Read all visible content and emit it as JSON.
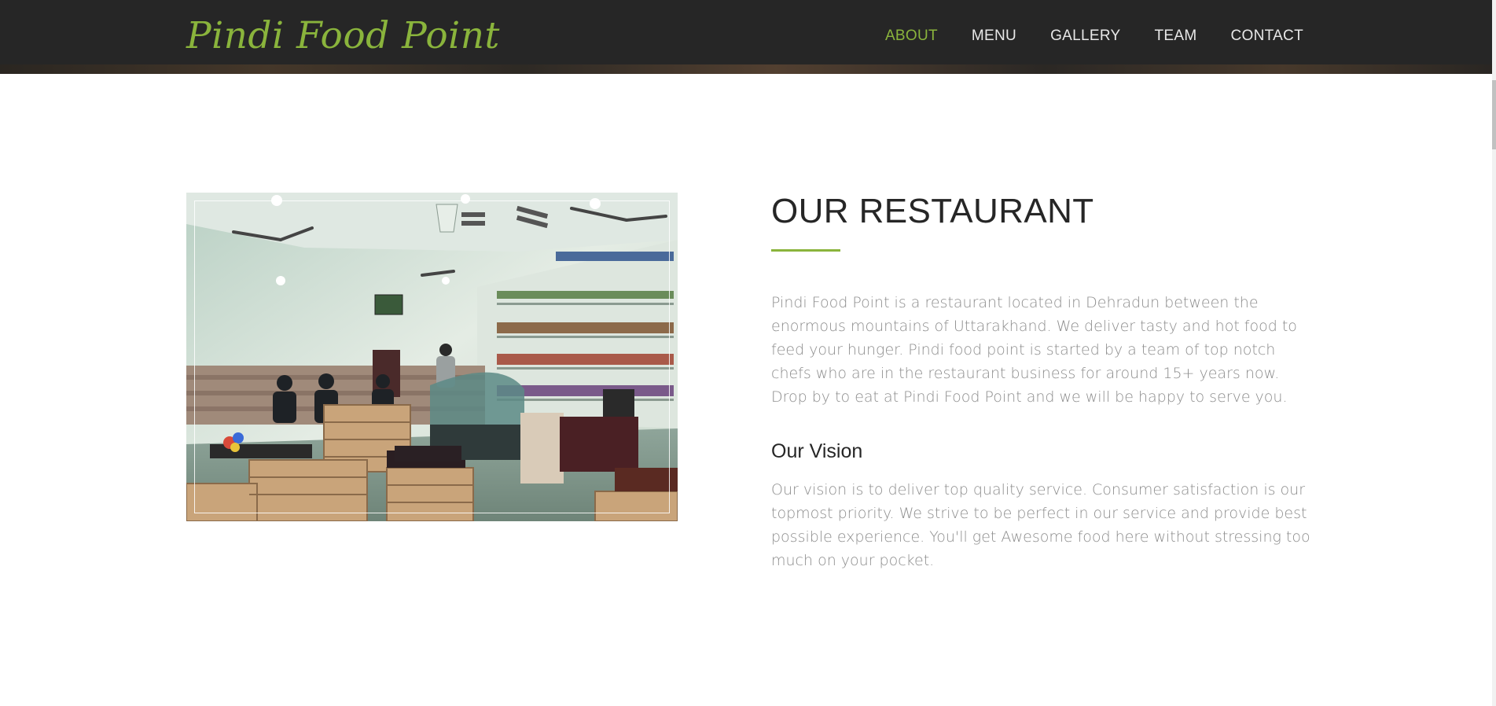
{
  "header": {
    "brand": "Pindi Food Point",
    "nav": [
      {
        "label": "ABOUT",
        "active": true
      },
      {
        "label": "MENU",
        "active": false
      },
      {
        "label": "GALLERY",
        "active": false
      },
      {
        "label": "TEAM",
        "active": false
      },
      {
        "label": "CONTACT",
        "active": false
      }
    ]
  },
  "about": {
    "heading": "OUR RESTAURANT",
    "intro": "Pindi Food Point is a restaurant located in Dehradun between the enormous mountains of Uttarakhand. We deliver tasty and hot food to feed your hunger. Pindi food point is started by a team of top notch chefs who are in the restaurant business for around 15+ years now. Drop by to eat at Pindi Food Point and we will be happy to serve you.",
    "vision_heading": "Our Vision",
    "vision_text": "Our vision is to deliver top quality service. Consumer satisfaction is our topmost priority. We strive to be perfect in our service and provide best possible experience. You'll get Awesome food here without stressing too much on your pocket."
  },
  "colors": {
    "accent": "#8ab43c",
    "header_bg": "#262626",
    "heading_text": "#262626",
    "body_text": "#8d8d8d"
  }
}
